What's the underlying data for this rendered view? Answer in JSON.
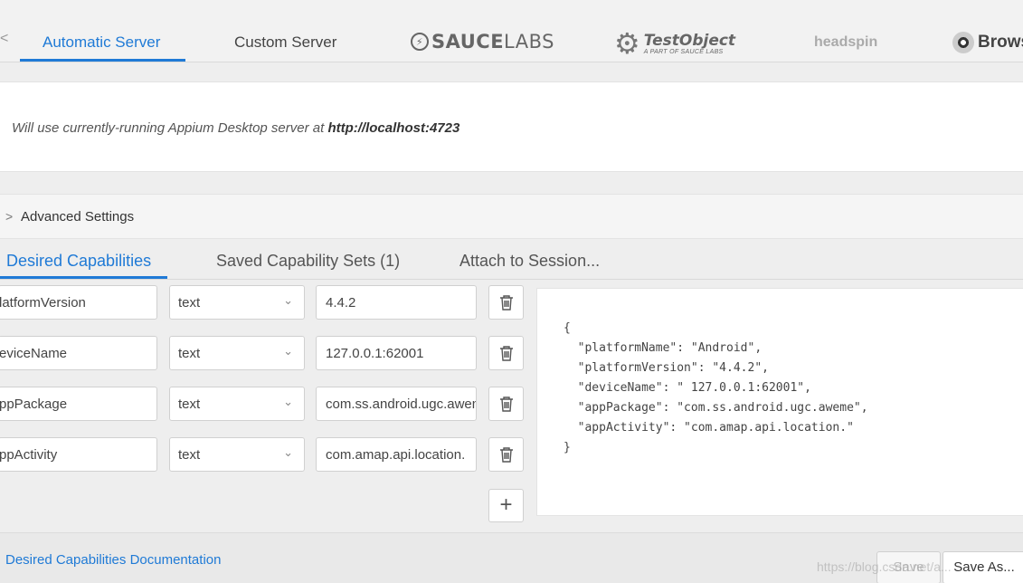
{
  "server_tabs": {
    "scroll_left_glyph": "<",
    "automatic": "Automatic Server",
    "custom": "Custom Server",
    "saucelabs": {
      "main": "SAUCE",
      "suffix": "LABS"
    },
    "testobject": {
      "name": "TestObject",
      "sub": "A PART OF SAUCE LABS"
    },
    "headspin": "headspin",
    "browserstack": "Browse"
  },
  "info": {
    "text": "Will use currently-running Appium Desktop server at ",
    "url": "http://localhost:4723"
  },
  "advanced": {
    "chevron": ">",
    "label": "Advanced Settings"
  },
  "cap_tabs": {
    "desired": "Desired Capabilities",
    "saved": "Saved Capability Sets (1)",
    "attach": "Attach to Session..."
  },
  "capabilities": [
    {
      "name": "latformVersion",
      "type": "text",
      "value": "4.4.2"
    },
    {
      "name": "eviceName",
      "type": "text",
      "value": " 127.0.0.1:62001"
    },
    {
      "name": "ppPackage",
      "type": "text",
      "value": "com.ss.android.ugc.aweme"
    },
    {
      "name": "ppActivity",
      "type": "text",
      "value": "com.amap.api.location."
    }
  ],
  "add_button": "+",
  "json_preview": "{\n  \"platformName\": \"Android\",\n  \"platformVersion\": \"4.4.2\",\n  \"deviceName\": \" 127.0.0.1:62001\",\n  \"appPackage\": \"com.ss.android.ugc.aweme\",\n  \"appActivity\": \"com.amap.api.location.\"\n}",
  "footer": {
    "doc_link": "Desired Capabilities Documentation",
    "save": "Save",
    "save_as": "Save As...",
    "watermark": "https://blog.csdn.net/a..."
  },
  "colors": {
    "accent": "#1f7ad6"
  },
  "icons": [
    "chevron-left-icon",
    "saucelabs-bolt-icon",
    "testobject-gear-icon",
    "browserstack-eye-icon",
    "chevron-right-icon",
    "chevron-down-icon",
    "trash-icon",
    "plus-icon"
  ]
}
